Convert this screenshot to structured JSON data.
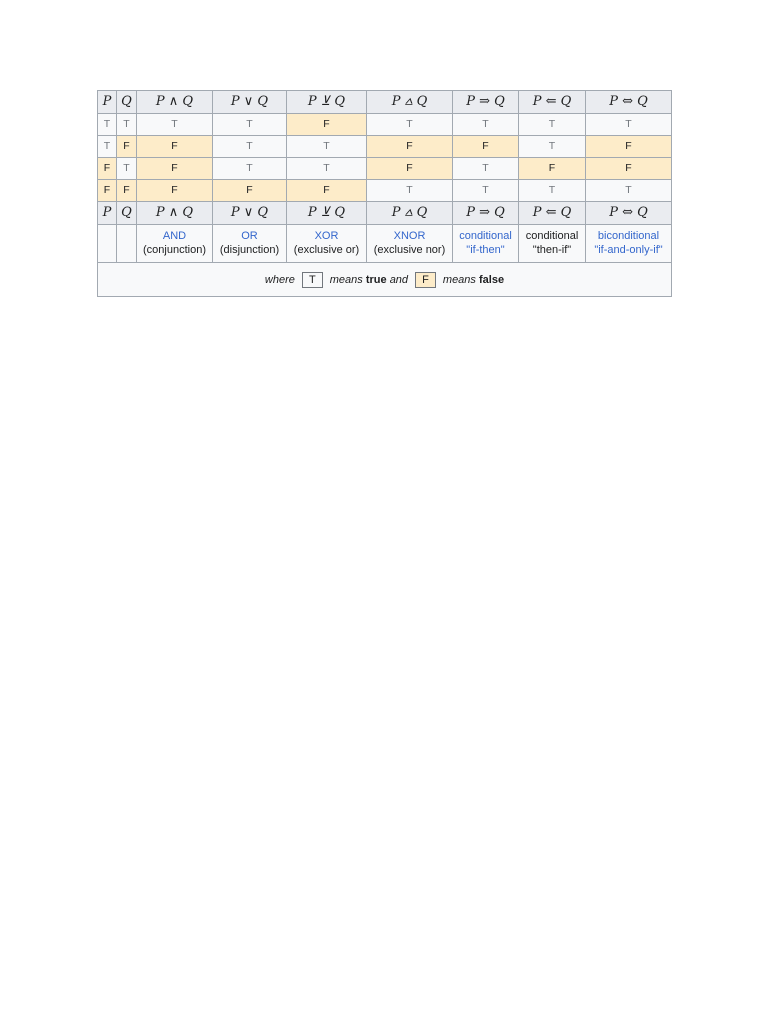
{
  "headers": [
    "P",
    "Q",
    "P ∧ Q",
    "P ∨ Q",
    "P ⊻ Q",
    "P ⩟ Q",
    "P ⇒ Q",
    "P ⇐ Q",
    "P ⇔ Q"
  ],
  "rows": [
    [
      "T",
      "T",
      "T",
      "T",
      "F",
      "T",
      "T",
      "T",
      "T"
    ],
    [
      "T",
      "F",
      "F",
      "T",
      "T",
      "F",
      "F",
      "T",
      "F"
    ],
    [
      "F",
      "T",
      "F",
      "T",
      "T",
      "F",
      "T",
      "F",
      "F"
    ],
    [
      "F",
      "F",
      "F",
      "F",
      "F",
      "T",
      "T",
      "T",
      "T"
    ]
  ],
  "operations": [
    {
      "name": "AND",
      "desc": "(conjunction)"
    },
    {
      "name": "OR",
      "desc": "(disjunction)"
    },
    {
      "name": "XOR",
      "desc": "(exclusive or)"
    },
    {
      "name": "XNOR",
      "desc": "(exclusive nor)"
    },
    {
      "name": "conditional",
      "desc": "\"if-then\""
    },
    {
      "name": "conditional",
      "desc": "\"then-if\""
    },
    {
      "name": "biconditional",
      "desc": "\"if-and-only-if\""
    }
  ],
  "legend": {
    "where": "where",
    "t_box": "T",
    "means1": "means",
    "true_word": "true",
    "and_word": "and",
    "f_box": "F",
    "means2": "means",
    "false_word": "false"
  },
  "colors": {
    "true_bg": "#f8f9fa",
    "false_bg": "#fdecc9",
    "header_bg": "#eaecf0",
    "link": "#3366cc"
  }
}
